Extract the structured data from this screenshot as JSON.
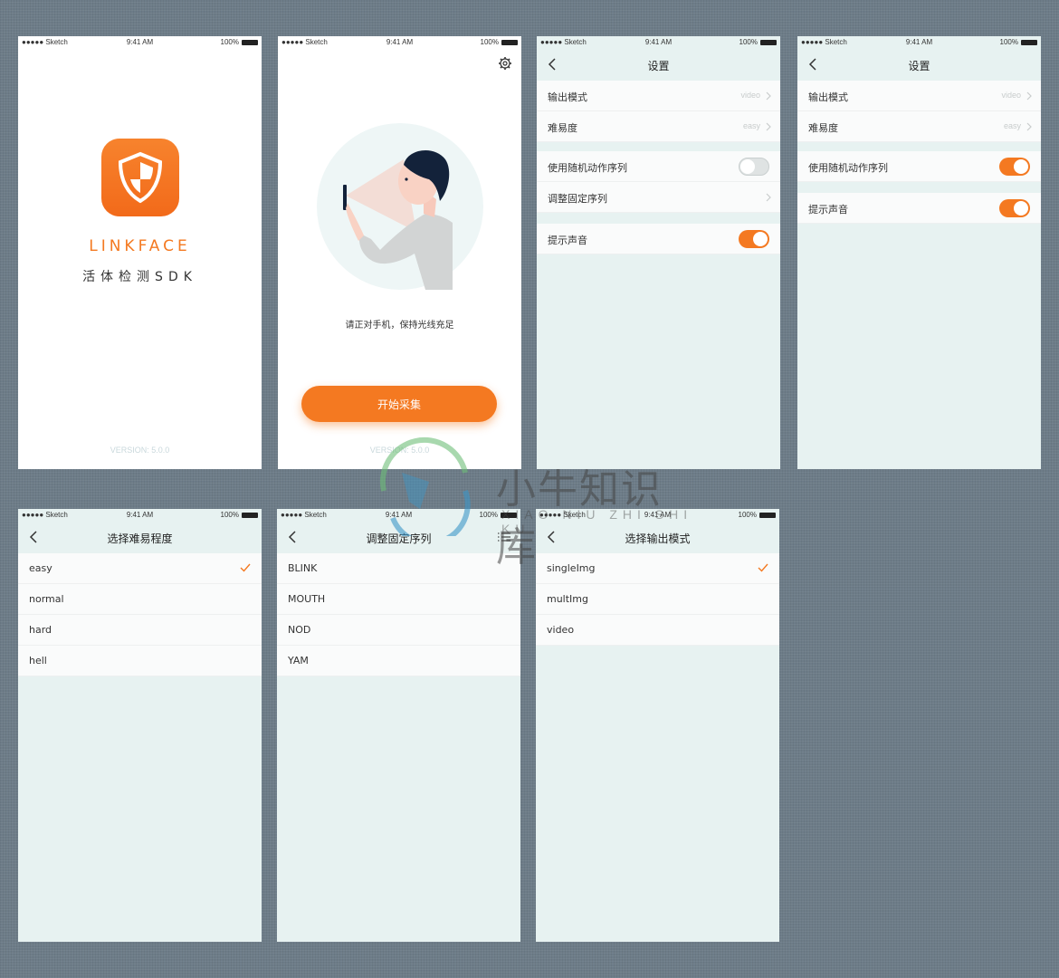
{
  "colors": {
    "accent": "#f47921",
    "background": "#6d7c88",
    "list_bg": "#e7f2f1"
  },
  "statusbar": {
    "carrier": "●●●●● Sketch",
    "time": "9:41 AM",
    "battery": "100%"
  },
  "splash": {
    "brand": "LINKFACE",
    "subtitle": "活体检测SDK",
    "version": "VERSION: 5.0.0",
    "icon": "shield-logo-icon"
  },
  "guide": {
    "hint": "请正对手机，保持光线充足",
    "button": "开始采集",
    "version": "VERSION: 5.0.0",
    "icon": "gear-icon"
  },
  "settings1": {
    "title": "设置",
    "rows": [
      {
        "label": "输出模式",
        "value": "video"
      },
      {
        "label": "难易度",
        "value": "easy"
      },
      {
        "label": "使用随机动作序列",
        "toggle": "off"
      },
      {
        "label": "调整固定序列"
      },
      {
        "label": "提示声音",
        "toggle": "on"
      }
    ]
  },
  "settings2": {
    "title": "设置",
    "rows": [
      {
        "label": "输出模式",
        "value": "video"
      },
      {
        "label": "难易度",
        "value": "easy"
      },
      {
        "label": "使用随机动作序列",
        "toggle": "on"
      },
      {
        "label": "提示声音",
        "toggle": "on"
      }
    ]
  },
  "difficulty": {
    "title": "选择难易程度",
    "items": [
      "easy",
      "normal",
      "hard",
      "hell"
    ],
    "selected": "easy"
  },
  "sequence": {
    "title": "调整固定序列",
    "items": [
      "BLINK",
      "MOUTH",
      "NOD",
      "YAM"
    ]
  },
  "output": {
    "title": "选择输出模式",
    "items": [
      "singleImg",
      "multImg",
      "video"
    ],
    "selected": "singleImg"
  },
  "watermark": {
    "text": "小牛知识库",
    "sub": "XIAO NIU ZHI SHI KU"
  }
}
